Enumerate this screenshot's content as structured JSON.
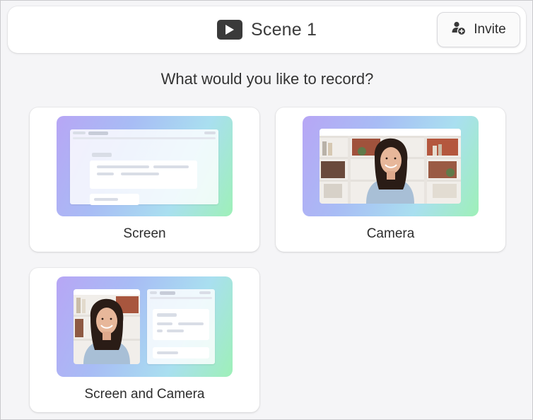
{
  "header": {
    "title": "Scene 1",
    "play_icon": "play-icon",
    "invite_label": "Invite",
    "invite_icon": "add-user-icon"
  },
  "prompt": "What would you like to record?",
  "options": [
    {
      "label": "Screen",
      "thumbnail": "screen-preview"
    },
    {
      "label": "Camera",
      "thumbnail": "camera-preview"
    },
    {
      "label": "Screen and Camera",
      "thumbnail": "screen-and-camera-preview"
    }
  ],
  "colors": {
    "background": "#f5f5f7",
    "card": "#ffffff",
    "gradient_start": "#b7a6f5",
    "gradient_end": "#9ef0b8"
  }
}
